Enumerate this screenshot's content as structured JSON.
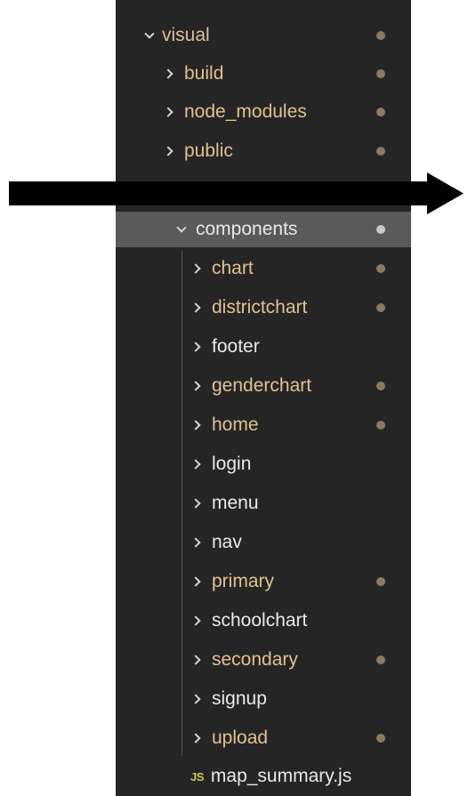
{
  "explorer": {
    "root": {
      "label": "visual",
      "modified": true
    },
    "top_folders": [
      {
        "label": "build",
        "modified": true
      },
      {
        "label": "node_modules",
        "modified": true
      },
      {
        "label": "public",
        "modified": true
      }
    ],
    "components": {
      "label": "components",
      "modified": true
    },
    "component_children": [
      {
        "label": "chart",
        "modified": true
      },
      {
        "label": "districtchart",
        "modified": true
      },
      {
        "label": "footer",
        "modified": false
      },
      {
        "label": "genderchart",
        "modified": true
      },
      {
        "label": "home",
        "modified": true
      },
      {
        "label": "login",
        "modified": false
      },
      {
        "label": "menu",
        "modified": false
      },
      {
        "label": "nav",
        "modified": false
      },
      {
        "label": "primary",
        "modified": true
      },
      {
        "label": "schoolchart",
        "modified": false
      },
      {
        "label": "secondary",
        "modified": true
      },
      {
        "label": "signup",
        "modified": false
      },
      {
        "label": "upload",
        "modified": true
      }
    ],
    "file": {
      "badge": "JS",
      "label": "map_summary.js"
    }
  },
  "colors": {
    "background": "#252526",
    "modified_text": "#e2c08d",
    "plain_text": "#e8e8e8",
    "selected_row": "#5a5a5a",
    "modified_dot": "#8c7a59",
    "js_badge": "#cbcb41",
    "arrow": "#000000"
  },
  "icons": {
    "collapsed": "chevron-right-icon",
    "expanded": "chevron-down-icon",
    "modified": "dot-icon",
    "js_file": "js-file-icon",
    "annotation": "arrow-right-icon"
  }
}
